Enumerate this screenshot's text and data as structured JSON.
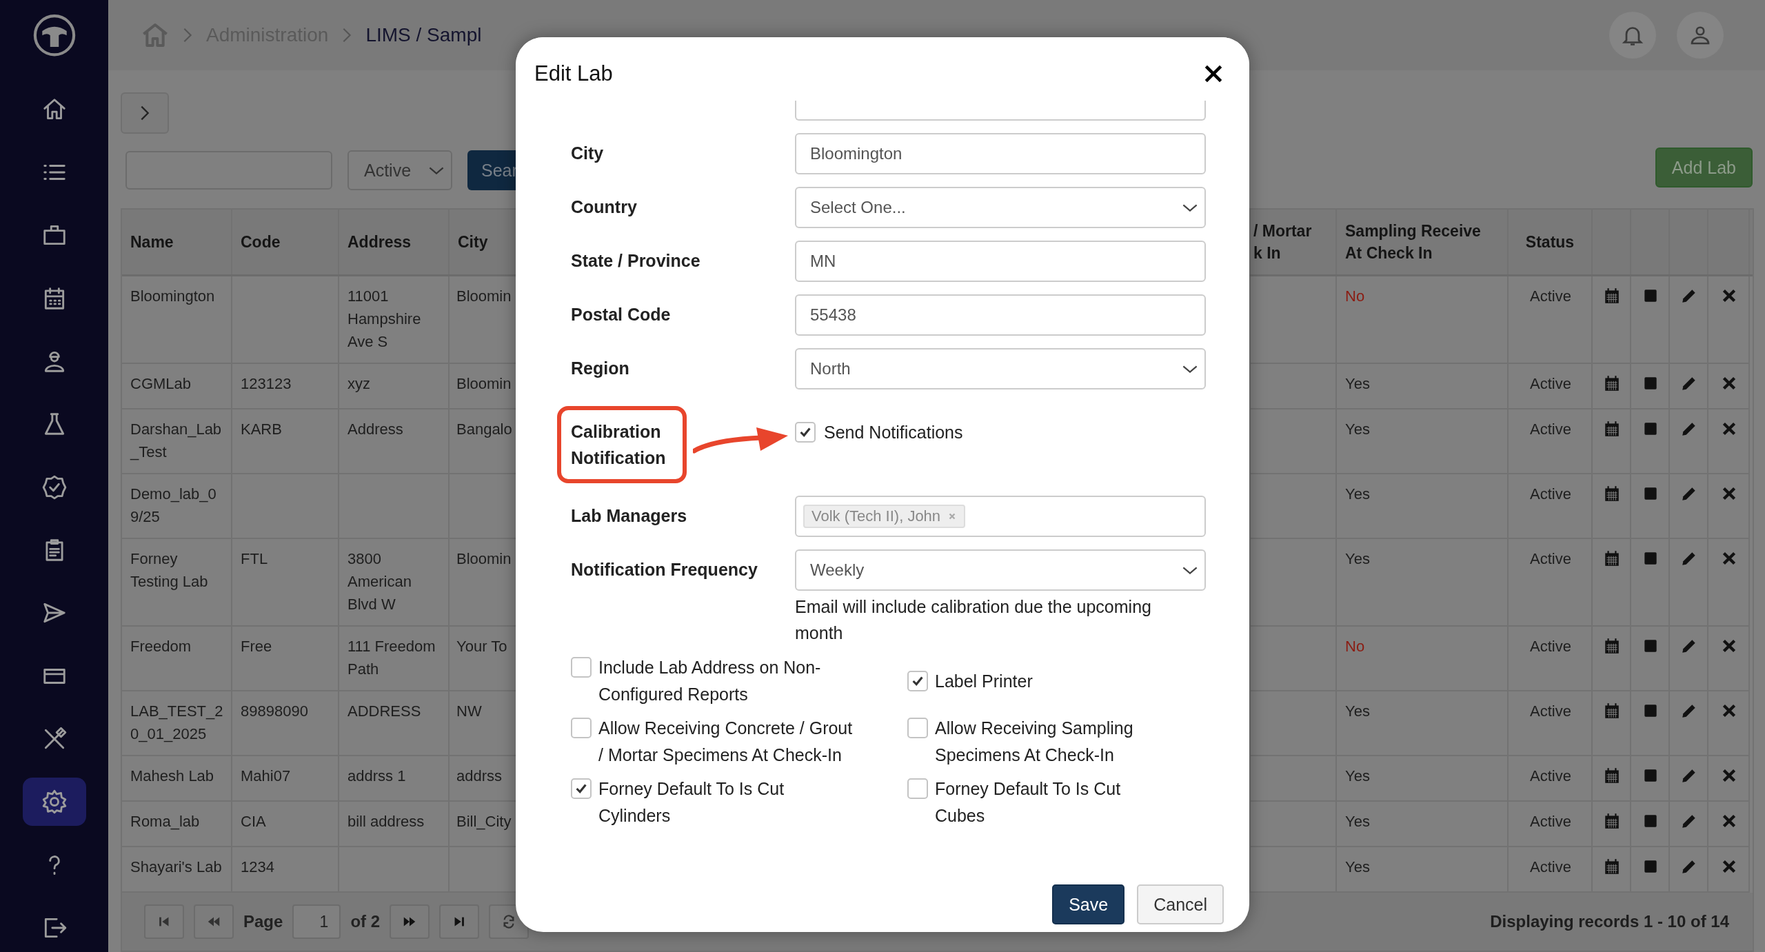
{
  "sidebar": {
    "items": [
      {
        "kind": "home",
        "selected": false
      },
      {
        "kind": "list",
        "selected": false
      },
      {
        "kind": "briefcase",
        "selected": false
      },
      {
        "kind": "calendar",
        "selected": false
      },
      {
        "kind": "worker",
        "selected": false
      },
      {
        "kind": "flask",
        "selected": false
      },
      {
        "kind": "badge",
        "selected": false
      },
      {
        "kind": "clipboard",
        "selected": false
      },
      {
        "kind": "send",
        "selected": false
      },
      {
        "kind": "card",
        "selected": false
      },
      {
        "kind": "tools",
        "selected": false
      },
      {
        "kind": "settings",
        "selected": true
      },
      {
        "kind": "help",
        "selected": false
      },
      {
        "kind": "logout",
        "selected": false
      }
    ]
  },
  "breadcrumb": [
    "Administration",
    "LIMS / Sampl"
  ],
  "toolbar": {
    "status_filter": "Active",
    "search_button": "Sear",
    "add_button": "Add Lab"
  },
  "table": {
    "columns": [
      {
        "label": "Name"
      },
      {
        "label": "Code"
      },
      {
        "label": "Address"
      },
      {
        "label": "City"
      },
      {
        "label": "/ Mortar\nk In"
      },
      {
        "label": "Sampling Receive At Check In"
      },
      {
        "label": "Status"
      }
    ],
    "rows": [
      {
        "name": "Bloomington",
        "address": "11001 Hampshire Ave S",
        "city": "Bloomin",
        "sampling": "No",
        "sampling_negative": true,
        "status": "Active"
      },
      {
        "name": "CGMLab",
        "code": "123123",
        "address": "xyz",
        "city": "Bloomin",
        "sampling": "Yes",
        "sampling_negative": false,
        "status": "Active"
      },
      {
        "name": "Darshan_Lab_Test",
        "code": "KARB",
        "address": "Address",
        "city": "Bangalo",
        "sampling": "Yes",
        "sampling_negative": false,
        "status": "Active"
      },
      {
        "name": "Demo_lab_09/25",
        "sampling": "Yes",
        "sampling_negative": false,
        "status": "Active"
      },
      {
        "name": "Forney Testing Lab",
        "code": "FTL",
        "address": "3800 American Blvd W",
        "city": "Bloomin",
        "sampling": "Yes",
        "sampling_negative": false,
        "status": "Active"
      },
      {
        "name": "Freedom",
        "code": "Free",
        "address": "111 Freedom Path",
        "city": "Your To",
        "sampling": "No",
        "sampling_negative": true,
        "status": "Active"
      },
      {
        "name": "LAB_TEST_20_01_2025",
        "code": "89898090",
        "address": "ADDRESS",
        "city": "NW",
        "sampling": "Yes",
        "sampling_negative": false,
        "status": "Active"
      },
      {
        "name": "Mahesh Lab",
        "code": "Mahi07",
        "address": "addrss 1",
        "city": "addrss",
        "sampling": "Yes",
        "sampling_negative": false,
        "status": "Active"
      },
      {
        "name": "Roma_lab",
        "code": "CIA",
        "address": "bill address",
        "city": "Bill_City",
        "sampling": "Yes",
        "sampling_negative": false,
        "status": "Active"
      },
      {
        "name": "Shayari's Lab",
        "code": "1234",
        "sampling": "Yes",
        "sampling_negative": false,
        "status": "Active"
      }
    ]
  },
  "pagination": {
    "page_label": "Page",
    "page": "1",
    "of": "of 2",
    "summary": "Displaying records 1 - 10 of 14"
  },
  "modal": {
    "title": "Edit Lab",
    "fields": [
      {
        "label": "City",
        "kind": "text",
        "value": "Bloomington"
      },
      {
        "label": "Country",
        "kind": "select",
        "value": "Select One..."
      },
      {
        "label": "State / Province",
        "kind": "text",
        "value": "MN"
      },
      {
        "label": "Postal Code",
        "kind": "text",
        "value": "55438"
      },
      {
        "label": "Region",
        "kind": "select",
        "value": "North"
      },
      {
        "label": "Calibration Notification",
        "kind": "checkbox",
        "text": "Send Notifications",
        "checked": true,
        "highlighted": true
      },
      {
        "label": "Lab Managers",
        "kind": "tags",
        "tags": [
          "Volk (Tech II), John"
        ]
      },
      {
        "label": "Notification Frequency",
        "kind": "select",
        "value": "Weekly",
        "help": "Email will include calibration due the upcoming month"
      }
    ],
    "options": [
      {
        "label": "Include Lab Address on Non-Configured Reports",
        "checked": false
      },
      {
        "label": "Label Printer",
        "checked": true
      },
      {
        "label": "Allow Receiving Concrete / Grout / Mortar Specimens At Check-In",
        "checked": false
      },
      {
        "label": "Allow Receiving Sampling Specimens At Check-In",
        "checked": false
      },
      {
        "label": "Forney Default To Is Cut Cylinders",
        "checked": true
      },
      {
        "label": "Forney Default To Is Cut Cubes",
        "checked": false
      }
    ],
    "buttons": [
      {
        "label": "Save",
        "kind": "primary"
      },
      {
        "label": "Cancel",
        "kind": "secondary"
      }
    ]
  }
}
